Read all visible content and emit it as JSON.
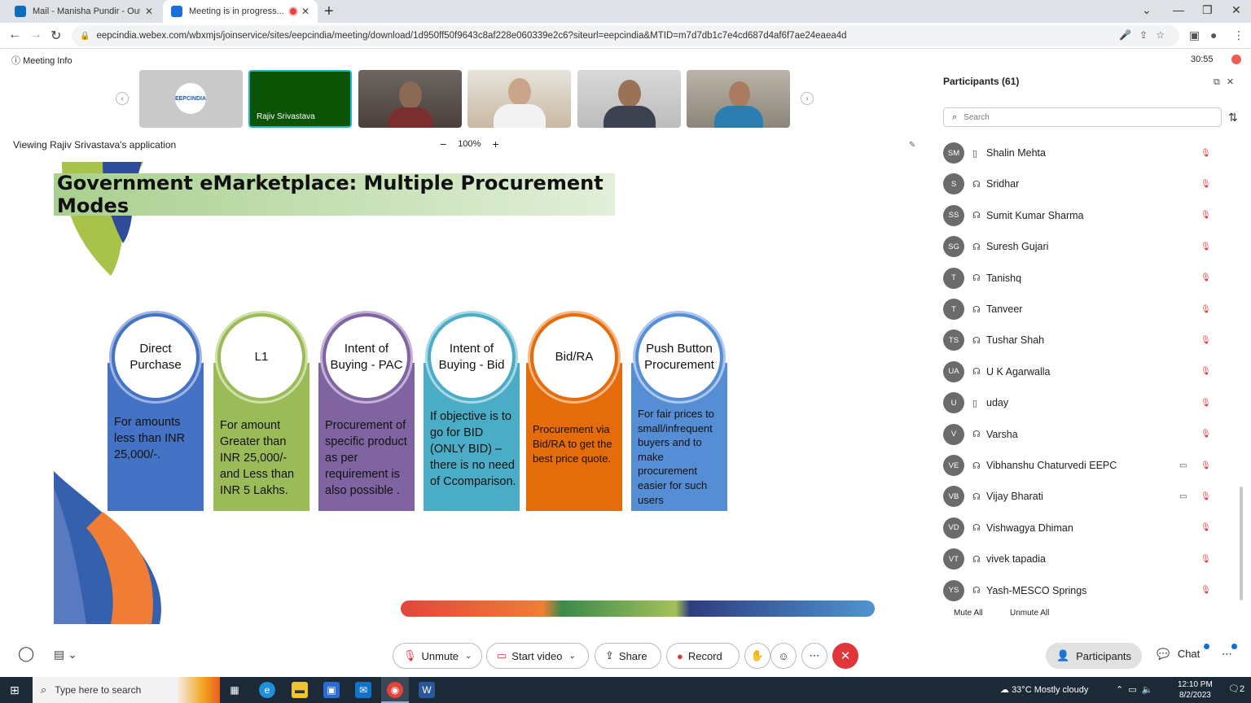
{
  "browser": {
    "tabs": [
      {
        "title": "Mail - Manisha Pundir - Outlook",
        "icon": "outlook-icon"
      },
      {
        "title": "Meeting is in progress...",
        "icon": "webex-icon"
      }
    ],
    "url": "eepcindia.webex.com/wbxmjs/joinservice/sites/eepcindia/meeting/download/1d950ff50f9643c8af228e060339e2c6?siteurl=eepcindia&MTID=m7d7db1c7e4cd687d4af6f7ae24eaea4d"
  },
  "meeting": {
    "info_label": "Meeting Info",
    "timer": "30:55",
    "active_speaker": "Rajiv Srivastava",
    "viewing_label": "Viewing Rajiv Srivastava's application",
    "zoom_level": "100%"
  },
  "thumbnail_logo": "EEPCINDIA",
  "slide": {
    "title": "Government eMarketplace: Multiple Procurement Modes",
    "modes": [
      {
        "heading": "Direct Purchase",
        "text": "For amounts less than INR 25,000/-.",
        "color": "#4472c4"
      },
      {
        "heading": "L1",
        "text": "For amount Greater than INR 25,000/- and Less than INR 5 Lakhs.",
        "color": "#9bbb59"
      },
      {
        "heading": "Intent of Buying - PAC",
        "text": "Procurement of specific product as per requirement is also possible .",
        "color": "#8064a2"
      },
      {
        "heading": "Intent of Buying - Bid",
        "text": "If objective is to go for BID (ONLY BID) – there is no need of Ccomparison.",
        "color": "#4bacc6"
      },
      {
        "heading": "Bid/RA",
        "text": "Procurement via Bid/RA to get the best price quote.",
        "color": "#e46c0a"
      },
      {
        "heading": "Push Button Procurement",
        "text": "For fair prices to small/infrequent buyers and to make procurement easier for such users",
        "color": "#558ed5"
      }
    ]
  },
  "participants": {
    "title": "Participants (61)",
    "search_placeholder": "Search",
    "list": [
      {
        "initials": "SM",
        "name": "Shalin Mehta",
        "device": "phone",
        "video": false
      },
      {
        "initials": "S",
        "name": "Sridhar",
        "device": "headset",
        "video": false
      },
      {
        "initials": "SS",
        "name": "Sumit Kumar Sharma",
        "device": "headset",
        "video": false
      },
      {
        "initials": "SG",
        "name": "Suresh Gujari",
        "device": "headset",
        "video": false
      },
      {
        "initials": "T",
        "name": "Tanishq",
        "device": "headset",
        "video": false
      },
      {
        "initials": "T",
        "name": "Tanveer",
        "device": "headset",
        "video": false
      },
      {
        "initials": "TS",
        "name": "Tushar Shah",
        "device": "headset",
        "video": false
      },
      {
        "initials": "UA",
        "name": "U K Agarwalla",
        "device": "headset",
        "video": false
      },
      {
        "initials": "U",
        "name": "uday",
        "device": "phone",
        "video": false
      },
      {
        "initials": "V",
        "name": "Varsha",
        "device": "headset",
        "video": false
      },
      {
        "initials": "VE",
        "name": "Vibhanshu Chaturvedi EEPC",
        "device": "headset",
        "video": true
      },
      {
        "initials": "VB",
        "name": "Vijay Bharati",
        "device": "headset",
        "video": true
      },
      {
        "initials": "VD",
        "name": "Vishwagya Dhiman",
        "device": "headset",
        "video": false
      },
      {
        "initials": "VT",
        "name": "vivek tapadia",
        "device": "headset",
        "video": false
      },
      {
        "initials": "YS",
        "name": "Yash-MESCO Springs",
        "device": "headset",
        "video": false
      }
    ],
    "mute_all": "Mute All",
    "unmute_all": "Unmute All"
  },
  "controls": {
    "unmute": "Unmute",
    "start_video": "Start video",
    "share": "Share",
    "record": "Record",
    "participants": "Participants",
    "chat": "Chat"
  },
  "taskbar": {
    "search_placeholder": "Type here to search",
    "weather": "33°C  Mostly cloudy",
    "time": "12:10 PM",
    "date": "8/2/2023",
    "notifications": "2"
  }
}
